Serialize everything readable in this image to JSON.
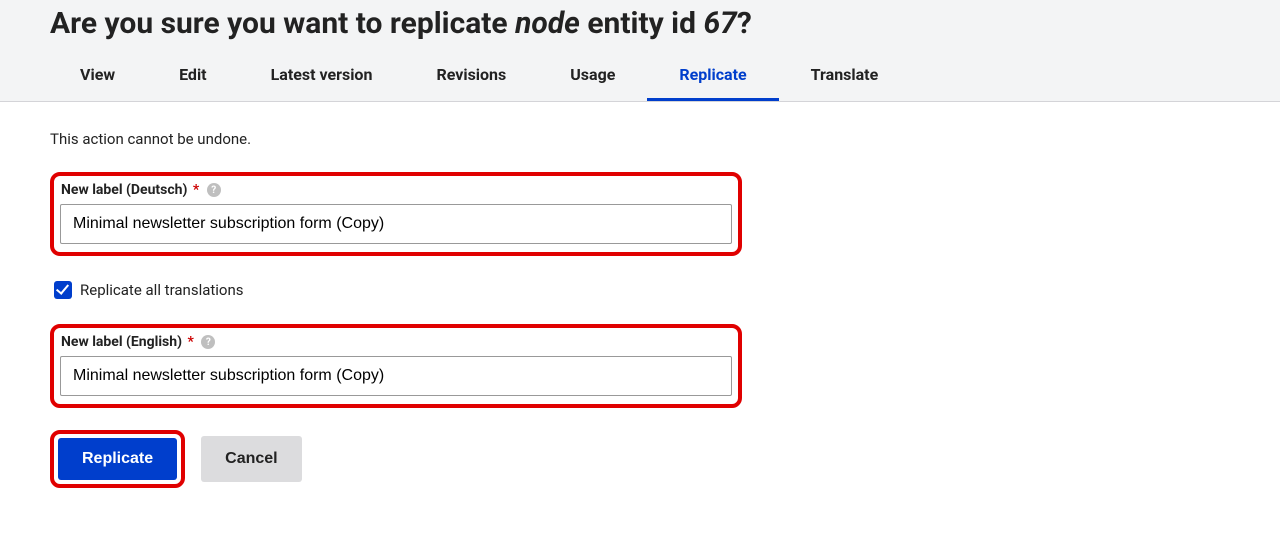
{
  "title": {
    "prefix": "Are you sure you want to replicate ",
    "entity_type": "node",
    "mid": " entity id ",
    "entity_id": "67",
    "suffix": "?"
  },
  "tabs": [
    {
      "label": "View",
      "active": false
    },
    {
      "label": "Edit",
      "active": false
    },
    {
      "label": "Latest version",
      "active": false
    },
    {
      "label": "Revisions",
      "active": false
    },
    {
      "label": "Usage",
      "active": false
    },
    {
      "label": "Replicate",
      "active": true
    },
    {
      "label": "Translate",
      "active": false
    }
  ],
  "warning": "This action cannot be undone.",
  "fields": {
    "label_de": {
      "label": "New label (Deutsch)",
      "value": "Minimal newsletter subscription form (Copy)",
      "required": true
    },
    "replicate_translations": {
      "label": "Replicate all translations",
      "checked": true
    },
    "label_en": {
      "label": "New label (English)",
      "value": "Minimal newsletter subscription form (Copy)",
      "required": true
    }
  },
  "actions": {
    "primary": "Replicate",
    "cancel": "Cancel"
  },
  "required_indicator": "*",
  "help_glyph": "?"
}
